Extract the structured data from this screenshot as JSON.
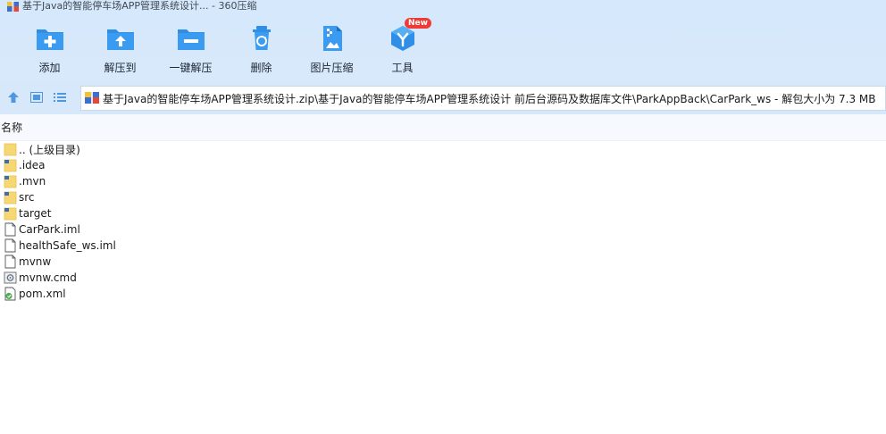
{
  "window": {
    "title": "基于Java的智能停车场APP管理系统设计... - 360压缩"
  },
  "toolbar": {
    "buttons": [
      {
        "label": "添加",
        "icon": "add-icon"
      },
      {
        "label": "解压到",
        "icon": "extract-to-icon"
      },
      {
        "label": "一键解压",
        "icon": "one-click-extract-icon"
      },
      {
        "label": "删除",
        "icon": "delete-icon"
      },
      {
        "label": "图片压缩",
        "icon": "image-compress-icon"
      },
      {
        "label": "工具",
        "icon": "tools-icon",
        "badge": "New"
      }
    ]
  },
  "address": {
    "path": "基于Java的智能停车场APP管理系统设计.zip\\基于Java的智能停车场APP管理系统设计 前后台源码及数据库文件\\ParkAppBack\\CarPark_ws - 解包大小为 7.3 MB"
  },
  "columns": {
    "name": "名称"
  },
  "files": [
    {
      "name": ".. (上级目录)",
      "type": "folder"
    },
    {
      "name": ".idea",
      "type": "folder-dot"
    },
    {
      "name": ".mvn",
      "type": "folder-dot"
    },
    {
      "name": "src",
      "type": "folder-dot"
    },
    {
      "name": "target",
      "type": "folder-dot"
    },
    {
      "name": "CarPark.iml",
      "type": "file"
    },
    {
      "name": "healthSafe_ws.iml",
      "type": "file"
    },
    {
      "name": "mvnw",
      "type": "file"
    },
    {
      "name": "mvnw.cmd",
      "type": "cmd"
    },
    {
      "name": "pom.xml",
      "type": "xml"
    }
  ],
  "colors": {
    "accent": "#2f8ee6",
    "toolbar_bg": "#d6e8fb",
    "folder": "#f7d774",
    "badge": "#ef3b36"
  }
}
